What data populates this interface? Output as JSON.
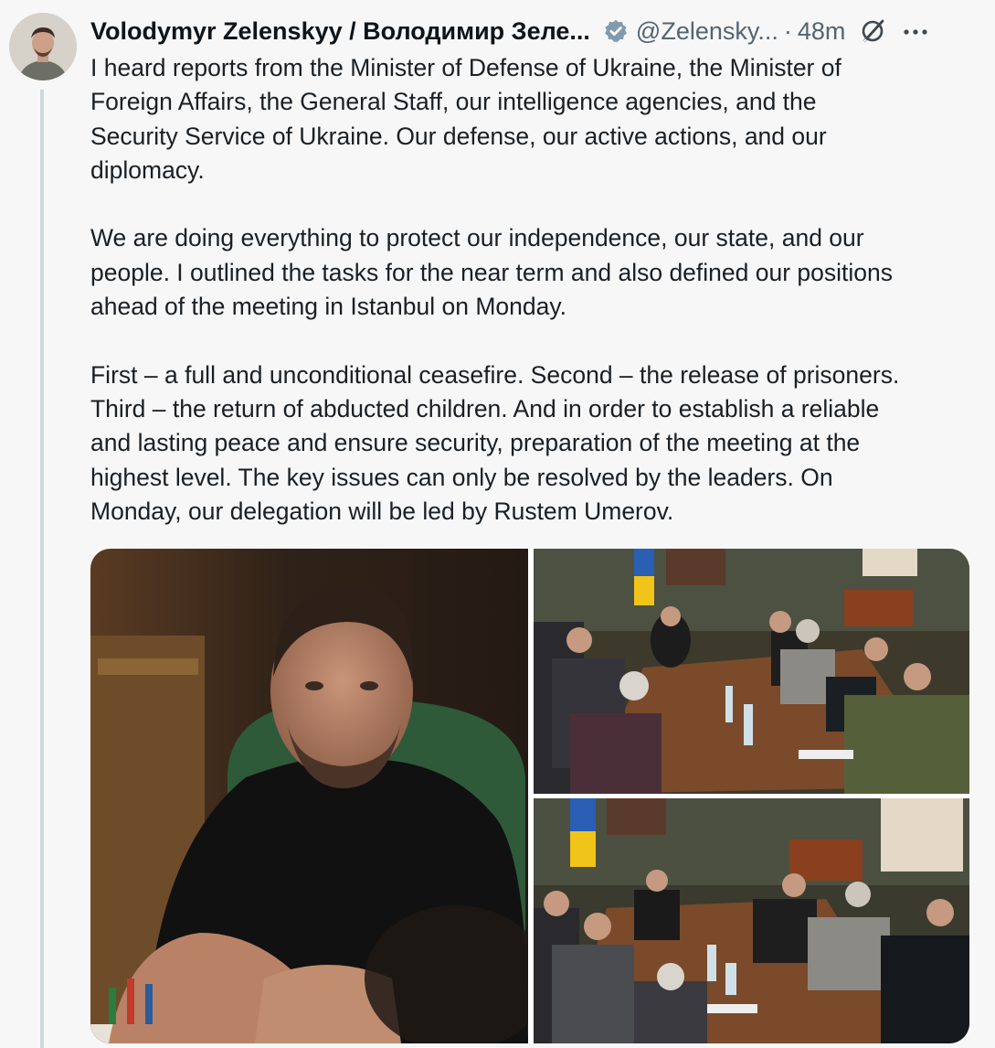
{
  "author": {
    "display_name": "Volodymyr Zelenskyy / Володимир Зеле...",
    "handle": "@Zelensky...",
    "separator": "·",
    "time_ago": "48m",
    "verified_color": "#829aab"
  },
  "post": {
    "paragraphs": [
      [
        "I heard reports from the Minister of Defense of Ukraine, the Minister of",
        "Foreign Affairs, the General Staff, our intelligence agencies, and the",
        "Security Service of Ukraine. Our defense, our active actions, and our",
        "diplomacy."
      ],
      [
        "We are doing everything to protect our independence, our state, and our",
        "people. I outlined the tasks for the near term and also defined our positions",
        "ahead of the meeting in Istanbul on Monday."
      ],
      [
        "First – a full and unconditional ceasefire. Second – the release of prisoners.",
        "Third – the return of abducted children. And in order to establish a reliable",
        "and lasting peace and ensure security, preparation of the meeting at the",
        "highest level. The key issues can only be resolved by the leaders. On",
        "Monday, our delegation will be led by Rustem Umerov."
      ]
    ]
  },
  "icons": {
    "avatar": "avatar",
    "verified": "verified-badge-icon",
    "grok": "grok-icon",
    "more": "more-options-icon"
  },
  "colors": {
    "background": "#f7f7f7",
    "secondary_text": "#536471",
    "thread_line": "#cfd9de"
  }
}
